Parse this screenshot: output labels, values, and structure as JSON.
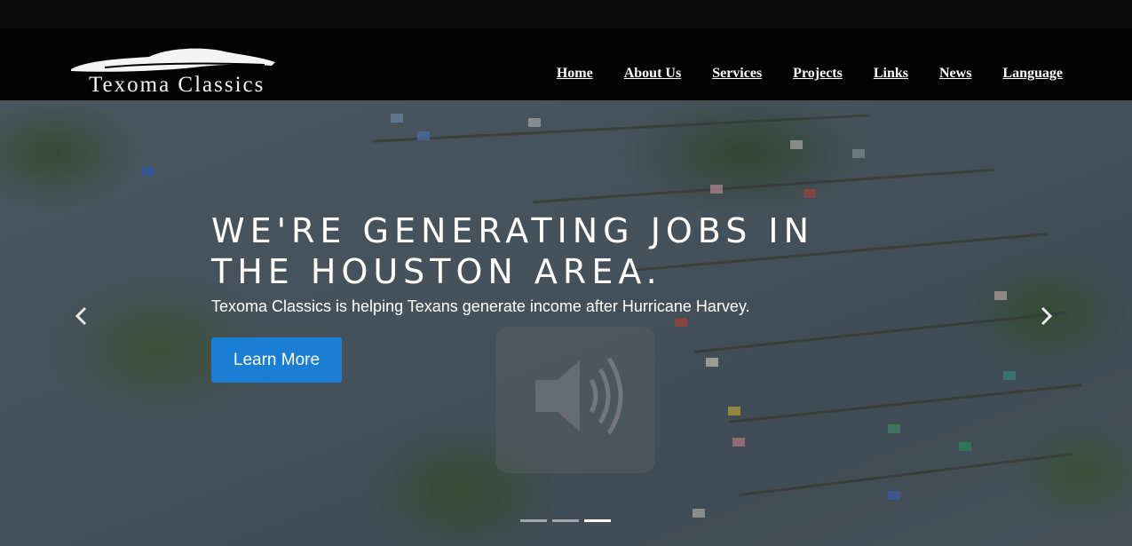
{
  "brand": {
    "name": "Texoma Classics"
  },
  "nav": {
    "items": [
      {
        "label": "Home"
      },
      {
        "label": "About Us"
      },
      {
        "label": "Services"
      },
      {
        "label": "Projects"
      },
      {
        "label": "Links"
      },
      {
        "label": "News"
      },
      {
        "label": "Language"
      }
    ]
  },
  "hero": {
    "headline": "We're generating jobs in the Houston area.",
    "subtext": "Texoma Classics is helping Texans generate income after Hurricane Harvey.",
    "cta_label": "Learn More",
    "prev_icon": "chevron-left-icon",
    "next_icon": "chevron-right-icon",
    "slides": {
      "count": 3,
      "active_index": 2
    },
    "background_image": "aerial view of flooded neighborhood"
  },
  "colors": {
    "button": "#1a7fd4",
    "navbar": "#030303"
  }
}
